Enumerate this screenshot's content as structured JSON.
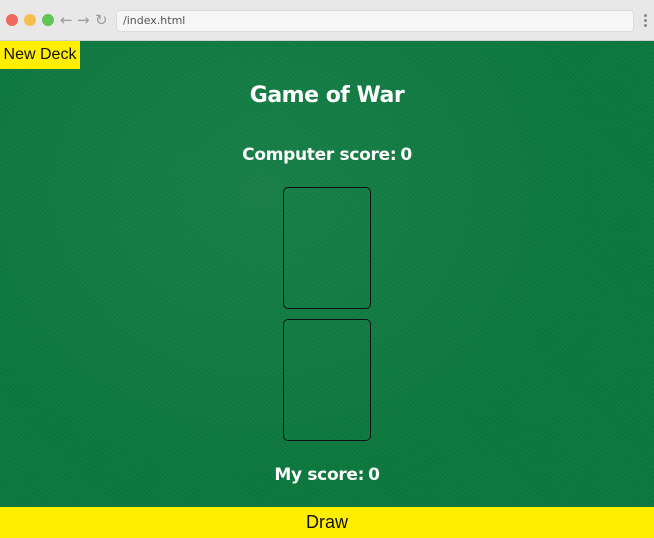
{
  "browser": {
    "url": "/index.html"
  },
  "game": {
    "new_deck_label": "New Deck",
    "title": "Game of War",
    "computer_score_label": "Computer score:",
    "computer_score": "0",
    "my_score_label": "My score:",
    "my_score": "0",
    "draw_label": "Draw"
  },
  "colors": {
    "felt": "#0b7a3e",
    "button": "#ffee00"
  }
}
